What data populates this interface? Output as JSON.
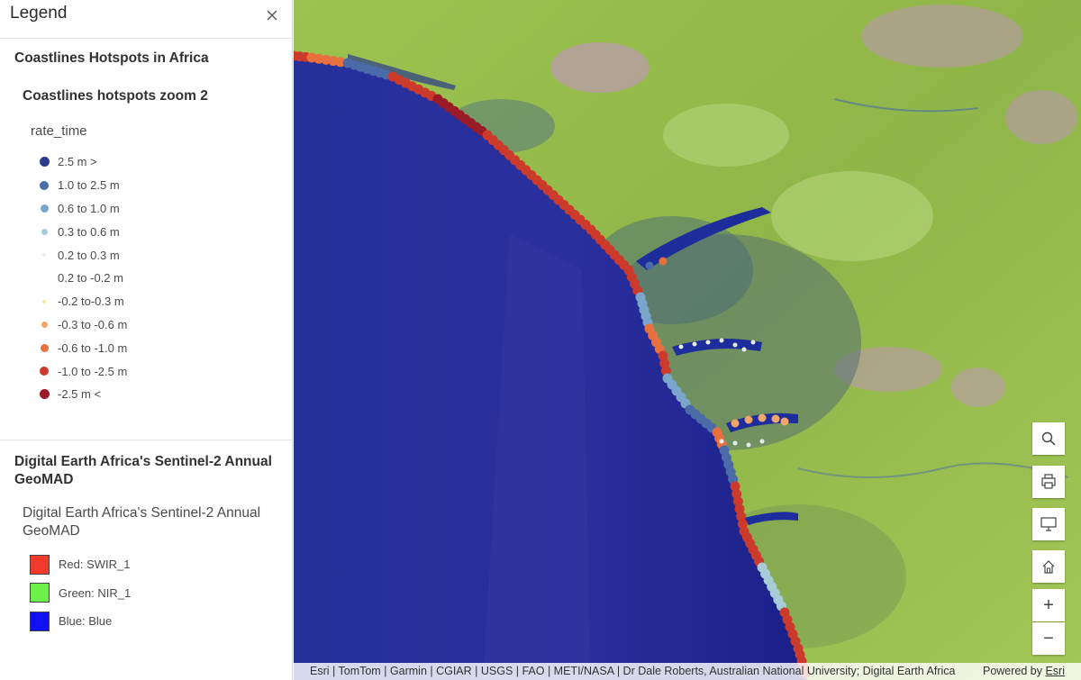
{
  "legend": {
    "title": "Legend",
    "close_icon": "close-icon",
    "layers": [
      {
        "title": "Coastlines Hotspots in Africa",
        "sublayer_title": "Coastlines hotspots zoom 2",
        "field": "rate_time",
        "classes": [
          {
            "label": "2.5 m >",
            "color": "#2a3a8c",
            "size": 11
          },
          {
            "label": "1.0 to 2.5 m",
            "color": "#4b6aa8",
            "size": 10
          },
          {
            "label": "0.6 to 1.0 m",
            "color": "#7aa6cc",
            "size": 9
          },
          {
            "label": "0.3 to 0.6 m",
            "color": "#a8cbd8",
            "size": 7
          },
          {
            "label": "0.2 to 0.3 m",
            "color": "#e6ecec",
            "size": 4
          },
          {
            "label": "0.2 to -0.2 m",
            "color": "#ffffff",
            "size": 0
          },
          {
            "label": "-0.2 to-0.3 m",
            "color": "#f3e6a3",
            "size": 4
          },
          {
            "label": "-0.3 to -0.6 m",
            "color": "#f2a56a",
            "size": 7
          },
          {
            "label": "-0.6 to -1.0 m",
            "color": "#e8703f",
            "size": 9
          },
          {
            "label": "-1.0 to -2.5 m",
            "color": "#cc3a2c",
            "size": 10
          },
          {
            "label": "-2.5 m <",
            "color": "#9a1a28",
            "size": 11
          }
        ]
      },
      {
        "title": "Digital Earth Africa's Sentinel-2 Annual GeoMAD",
        "sublayer_title": "Digital Earth Africa's Sentinel-2 Annual GeoMAD",
        "bands": [
          {
            "label": "Red: SWIR_1",
            "color": "#f03a2b"
          },
          {
            "label": "Green: NIR_1",
            "color": "#6ef04a"
          },
          {
            "label": "Blue: Blue",
            "color": "#1010f0"
          }
        ]
      }
    ]
  },
  "map": {
    "tools": [
      {
        "name": "search-button",
        "icon": "search-icon"
      },
      {
        "name": "print-button",
        "icon": "print-icon"
      },
      {
        "name": "fullscreen-button",
        "icon": "monitor-icon"
      },
      {
        "name": "home-button",
        "icon": "home-icon"
      },
      {
        "name": "zoom-in-button",
        "icon": "plus-icon",
        "label": "+"
      },
      {
        "name": "zoom-out-button",
        "icon": "minus-icon",
        "label": "−"
      }
    ],
    "attribution": "Esri | TomTom | Garmin | CGIAR | USGS | FAO | METI/NASA | Dr Dale Roberts, Australian National University; Digital Earth Africa",
    "powered_by_prefix": "Powered by ",
    "powered_by_link": "Esri",
    "colors": {
      "ocean": "#1f2a9e",
      "land": "#8fb84a",
      "water_inland": "#1c2f9a"
    }
  }
}
